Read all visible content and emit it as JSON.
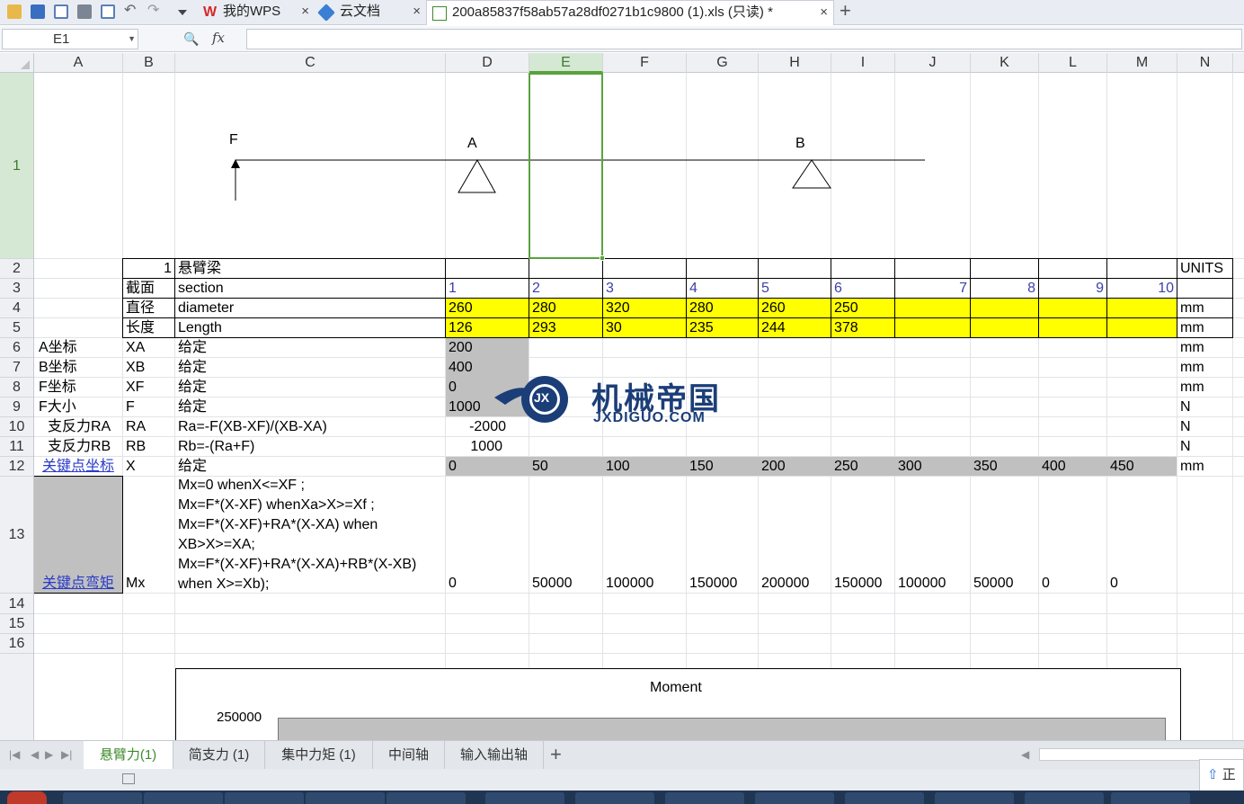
{
  "tabs": [
    {
      "label": "我的WPS"
    },
    {
      "label": "云文档"
    },
    {
      "label": "200a85837f58ab57a28df0271b1c9800 (1).xls (只读) *"
    }
  ],
  "namebox": "E1",
  "formula_label": "fx",
  "columns": [
    "A",
    "B",
    "C",
    "D",
    "E",
    "F",
    "G",
    "H",
    "I",
    "J",
    "K",
    "L",
    "M",
    "N"
  ],
  "rows": [
    "1",
    "2",
    "3",
    "4",
    "5",
    "6",
    "7",
    "8",
    "9",
    "10",
    "11",
    "12",
    "13",
    "14",
    "15",
    "16"
  ],
  "diagram": {
    "f_label": "F",
    "a_label": "A",
    "b_label": "B"
  },
  "cells": {
    "r2": {
      "b": "1",
      "c": "悬臂梁",
      "n": "UNITS"
    },
    "r3": {
      "b": "截面",
      "c": "section",
      "d": "1",
      "e": "2",
      "f": "3",
      "g": "4",
      "h": "5",
      "i": "6",
      "j": "7",
      "k": "8",
      "l": "9",
      "m": "10"
    },
    "r4": {
      "b": "直径",
      "c": "diameter",
      "d": "260",
      "e": "280",
      "f": "320",
      "g": "280",
      "h": "260",
      "i": "250",
      "n": "mm"
    },
    "r5": {
      "b": "长度",
      "c": "Length",
      "d": "126",
      "e": "293",
      "f": "30",
      "g": "235",
      "h": "244",
      "i": "378",
      "n": "mm"
    },
    "r6": {
      "a": "A坐标",
      "b": "XA",
      "c": "给定",
      "d": "200",
      "n": "mm"
    },
    "r7": {
      "a": "B坐标",
      "b": "XB",
      "c": "给定",
      "d": "400",
      "n": "mm"
    },
    "r8": {
      "a": "F坐标",
      "b": "XF",
      "c": "给定",
      "d": "0",
      "n": "mm"
    },
    "r9": {
      "a": "F大小",
      "b": "F",
      "c": "给定",
      "d": "1000",
      "n": "N"
    },
    "r10": {
      "a": "支反力RA",
      "b": "RA",
      "c": "Ra=-F(XB-XF)/(XB-XA)",
      "d": "-2000",
      "n": "N"
    },
    "r11": {
      "a": "支反力RB",
      "b": "RB",
      "c": "Rb=-(Ra+F)",
      "d": "1000",
      "n": "N"
    },
    "r12": {
      "a": "关键点坐标",
      "b": "X",
      "c": "给定",
      "d": "0",
      "e": "50",
      "f": "100",
      "g": "150",
      "h": "200",
      "i": "250",
      "j": "300",
      "k": "350",
      "l": "400",
      "m": "450",
      "n": "mm"
    },
    "r13": {
      "a": "关键点弯矩",
      "b": "Mx",
      "c_lines": [
        "Mx=0 whenX<=XF ;",
        "Mx=F*(X-XF) whenXa>X>=Xf ;",
        "Mx=F*(X-XF)+RA*(X-XA) when",
        "XB>X>=XA;",
        "Mx=F*(X-XF)+RA*(X-XA)+RB*(X-XB)",
        "when X>=Xb);"
      ],
      "d": "0",
      "e": "50000",
      "f": "100000",
      "g": "150000",
      "h": "200000",
      "i": "150000",
      "j": "100000",
      "k": "50000",
      "l": "0",
      "m": "0"
    }
  },
  "chart": {
    "title": "Moment",
    "ytick_top": "250000"
  },
  "watermark": {
    "cn": "机械帝国",
    "en": "JXDIGUO.COM",
    "badge": "JX"
  },
  "sheet_tabs": [
    "悬臂力(1)",
    "简支力 (1)",
    "集中力矩 (1)",
    "中间轴",
    "输入输出轴"
  ],
  "status_popup": "正"
}
